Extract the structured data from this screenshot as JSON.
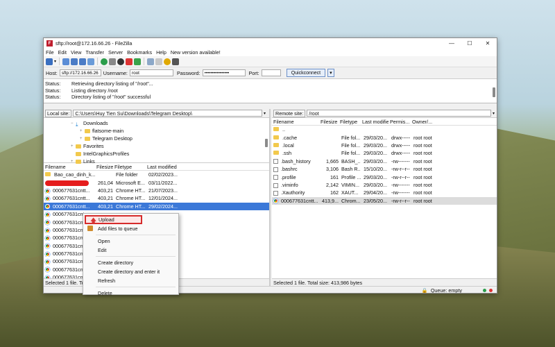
{
  "window": {
    "title": "sftp://root@172.16.66.26 - FileZilla",
    "app_icon": "filezilla-icon"
  },
  "menu": [
    "File",
    "Edit",
    "View",
    "Transfer",
    "Server",
    "Bookmarks",
    "Help",
    "New version available!"
  ],
  "quickconnect": {
    "host_label": "Host:",
    "host_value": "sftp://172.16.66.26",
    "username_label": "Username:",
    "username_value": "root",
    "password_label": "Password:",
    "password_value": "••••••••••••••••",
    "port_label": "Port:",
    "port_value": "",
    "button": "Quickconnect"
  },
  "log": [
    {
      "k": "Status:",
      "v": "Retrieving directory listing of \"/root\"..."
    },
    {
      "k": "Status:",
      "v": "Listing directory /root"
    },
    {
      "k": "Status:",
      "v": "Directory listing of \"/root\" successful"
    }
  ],
  "local": {
    "site_label": "Local site:",
    "path": "C:\\Users\\Huy Tien Su\\Downloads\\Telegram Desktop\\",
    "tree": [
      {
        "label": "Downloads",
        "indent": 3,
        "exp": "−",
        "icon": "download-icon"
      },
      {
        "label": "flatsome-main",
        "indent": 4,
        "exp": "+",
        "icon": "folder-icon"
      },
      {
        "label": "Telegram Desktop",
        "indent": 4,
        "exp": "+",
        "icon": "folder-icon"
      },
      {
        "label": "Favorites",
        "indent": 3,
        "exp": "+",
        "icon": "folder-icon"
      },
      {
        "label": "IntelGraphicsProfiles",
        "indent": 3,
        "exp": "",
        "icon": "folder-icon"
      },
      {
        "label": "Links",
        "indent": 3,
        "exp": "+",
        "icon": "folder-icon"
      }
    ],
    "headers": [
      "Filename",
      "Filesize",
      "Filetype",
      "Last modified"
    ],
    "rows": [
      {
        "icon": "folder",
        "name": "Bao_cao_dinh_k...",
        "size": "",
        "type": "File folder",
        "mod": "02/02/2023..."
      },
      {
        "icon": "redact",
        "name": "",
        "size": "261,046",
        "type": "Microsoft E...",
        "mod": "03/11/2022..."
      },
      {
        "icon": "chrome",
        "name": "000677631cntt...",
        "size": "403,218",
        "type": "Chrome HT...",
        "mod": "21/07/2023..."
      },
      {
        "icon": "chrome",
        "name": "000677631cntt...",
        "size": "403,218",
        "type": "Chrome HT...",
        "mod": "12/01/2024..."
      },
      {
        "icon": "chrome",
        "name": "000677631cntt...",
        "size": "403,218",
        "type": "Chrome HT...",
        "mod": "29/02/2024...",
        "sel": true
      },
      {
        "icon": "chrome",
        "name": "000677631cnt",
        "size": "",
        "type": "",
        "mod": ""
      },
      {
        "icon": "chrome",
        "name": "000677631cnt",
        "size": "",
        "type": "",
        "mod": ""
      },
      {
        "icon": "chrome",
        "name": "000677631cnt",
        "size": "",
        "type": "",
        "mod": ""
      },
      {
        "icon": "chrome",
        "name": "000677631cnt",
        "size": "",
        "type": "",
        "mod": ""
      },
      {
        "icon": "chrome",
        "name": "000677631cnt",
        "size": "",
        "type": "",
        "mod": ""
      },
      {
        "icon": "chrome",
        "name": "000677631cnt",
        "size": "",
        "type": "",
        "mod": ""
      },
      {
        "icon": "chrome",
        "name": "000677631cnt",
        "size": "",
        "type": "",
        "mod": ""
      },
      {
        "icon": "chrome",
        "name": "000677631cnt",
        "size": "",
        "type": "",
        "mod": ""
      },
      {
        "icon": "chrome",
        "name": "000677631cnt",
        "size": "",
        "type": "",
        "mod": ""
      }
    ],
    "status": "Selected 1 file. Total size: 403,218"
  },
  "remote": {
    "site_label": "Remote site:",
    "path": "/root",
    "headers": [
      "Filename",
      "Filesize",
      "Filetype",
      "Last modified",
      "Permis...",
      "Owner/..."
    ],
    "rows": [
      {
        "icon": "folder",
        "name": "..",
        "size": "",
        "type": "",
        "mod": "",
        "perm": "",
        "own": ""
      },
      {
        "icon": "folder",
        "name": ".cache",
        "size": "",
        "type": "File fol...",
        "mod": "29/03/20...",
        "perm": "drwx-----",
        "own": "root root"
      },
      {
        "icon": "folder",
        "name": ".local",
        "size": "",
        "type": "File fol...",
        "mod": "29/03/20...",
        "perm": "drwx-----",
        "own": "root root"
      },
      {
        "icon": "folder",
        "name": ".ssh",
        "size": "",
        "type": "File fol...",
        "mod": "29/03/20...",
        "perm": "drwx-----",
        "own": "root root"
      },
      {
        "icon": "doc",
        "name": ".bash_history",
        "size": "1,665",
        "type": "BASH_...",
        "mod": "29/03/20...",
        "perm": "-rw-------",
        "own": "root root"
      },
      {
        "icon": "doc",
        "name": ".bashrc",
        "size": "3,106",
        "type": "Bash R...",
        "mod": "15/10/20...",
        "perm": "-rw-r--r--",
        "own": "root root"
      },
      {
        "icon": "doc",
        "name": ".profile",
        "size": "161",
        "type": "Profile ...",
        "mod": "29/03/20...",
        "perm": "-rw-r--r--",
        "own": "root root"
      },
      {
        "icon": "doc",
        "name": ".viminfo",
        "size": "2,142",
        "type": "VIMIN...",
        "mod": "29/03/20...",
        "perm": "-rw-------",
        "own": "root root"
      },
      {
        "icon": "doc",
        "name": ".Xauthority",
        "size": "162",
        "type": "XAUT...",
        "mod": "29/04/20...",
        "perm": "-rw-------",
        "own": "root root"
      },
      {
        "icon": "chrome",
        "name": "000677631cntt...",
        "size": "413,9...",
        "type": "Chrom...",
        "mod": "23/05/20...",
        "perm": "-rw-r--r--",
        "own": "root root",
        "sel": true
      }
    ],
    "status": "Selected 1 file. Total size: 413,986 bytes"
  },
  "context_menu": {
    "items": [
      "Upload",
      "Add files to queue",
      "Open",
      "Edit",
      "Create directory",
      "Create directory and enter it",
      "Refresh",
      "Delete"
    ]
  },
  "queue": {
    "label": "Queue: empty"
  }
}
